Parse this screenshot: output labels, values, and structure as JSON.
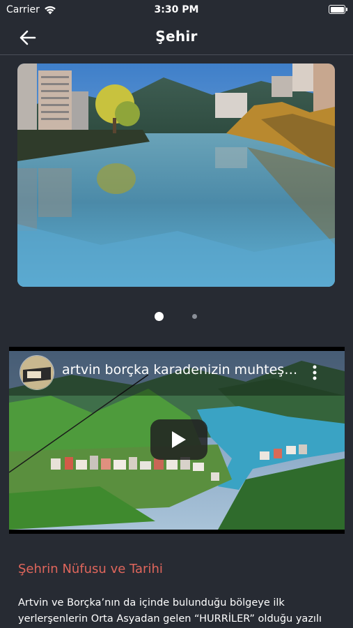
{
  "status_bar": {
    "carrier": "Carrier",
    "time": "3:30 PM"
  },
  "nav": {
    "title": "Şehir"
  },
  "carousel": {
    "active_index": 0,
    "total": 2
  },
  "video": {
    "title": "artvin borçka karadenizin muhteşem ilçesi"
  },
  "section": {
    "title": "Şehrin Nüfusu ve Tarihi",
    "text": "Artvin ve Borçka’nın da içinde bulunduğu bölgeye ilk yerlerşenlerin Orta Asyadan gelen “HURRİLER” olduğu yazılı"
  },
  "colors": {
    "background": "#272b33",
    "accent": "#e0665c"
  }
}
